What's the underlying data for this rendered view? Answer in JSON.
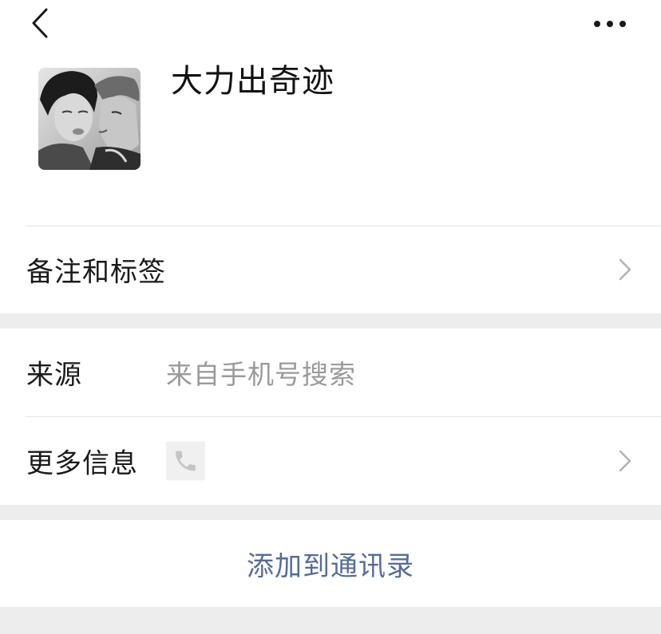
{
  "header": {
    "back_icon": "chevron-left-icon",
    "more_icon": "more-horizontal-icon",
    "nickname": "大力出奇迹"
  },
  "remark_row": {
    "label": "备注和标签",
    "icon": "chevron-right-icon"
  },
  "source_row": {
    "label": "来源",
    "value": "来自手机号搜索"
  },
  "more_info_row": {
    "label": "更多信息",
    "icon": "phone-icon",
    "chevron": "chevron-right-icon"
  },
  "action": {
    "add_label": "添加到通讯录"
  },
  "colors": {
    "background": "#ededed",
    "link": "#576b95",
    "secondary_text": "#9a9a9a"
  }
}
